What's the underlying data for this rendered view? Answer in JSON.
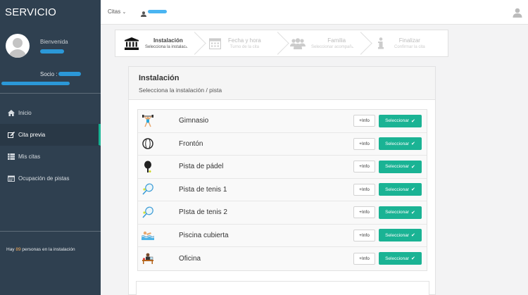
{
  "app": {
    "brand": "SERVICIO"
  },
  "profile": {
    "welcome": "Bienvenida",
    "socio_label": "Socio :"
  },
  "nav": [
    {
      "label": "Inicio",
      "icon": "home-icon",
      "active": false
    },
    {
      "label": "Cita previa",
      "icon": "edit-icon",
      "active": true
    },
    {
      "label": "Mis citas",
      "icon": "list-icon",
      "active": false
    },
    {
      "label": "Ocupación de pistas",
      "icon": "calendar-icon",
      "active": false
    }
  ],
  "footer": {
    "prefix": "Hay ",
    "count": "89",
    "suffix": " personas en la instalación"
  },
  "topbar": {
    "menu": "Citas"
  },
  "wizard": [
    {
      "title": "Instalación",
      "sub": "Selecciona la instalación",
      "icon": "institution-icon",
      "active": true
    },
    {
      "title": "Fecha y hora",
      "sub": "Turno de la cita",
      "icon": "calendar-icon",
      "active": false
    },
    {
      "title": "Familia",
      "sub": "Seleccionar acompañantes",
      "icon": "users-icon",
      "active": false
    },
    {
      "title": "Finalizar",
      "sub": "Confirmar la cita",
      "icon": "info-icon",
      "active": false
    }
  ],
  "panel": {
    "title": "Instalación",
    "subtitle": "Selecciona la instalación / pista",
    "info_label": "+Info",
    "select_label": "Seleccionar",
    "facilities": [
      {
        "name": "Gimnasio",
        "icon": "weightlifter-icon"
      },
      {
        "name": "Frontón",
        "icon": "ball-icon"
      },
      {
        "name": "Pista de pádel",
        "icon": "padel-racket-icon"
      },
      {
        "name": "Pista de tenis 1",
        "icon": "tennis-racket-icon"
      },
      {
        "name": "PIsta de tenis 2",
        "icon": "tennis-racket-icon"
      },
      {
        "name": "Piscina cubierta",
        "icon": "swimmer-icon"
      },
      {
        "name": "Oficina",
        "icon": "office-icon"
      }
    ]
  },
  "colors": {
    "sidebar": "#2f4050",
    "accent": "#1ab394",
    "highlight": "#f8ac59"
  }
}
